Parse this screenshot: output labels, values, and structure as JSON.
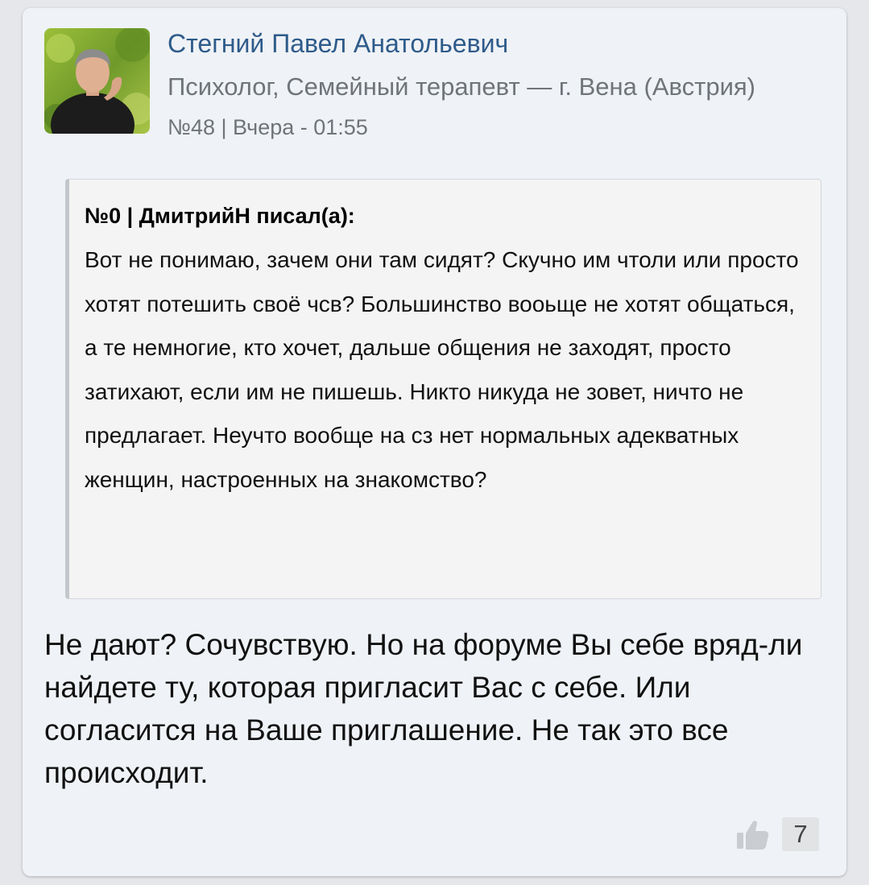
{
  "post": {
    "author": {
      "name": "Стегний Павел Анатольевич",
      "role": "Психолог, Семейный терапевт — г. Вена (Австрия)"
    },
    "meta": "№48 | Вчера - 01:55",
    "quote": {
      "header": "№0 | ДмитрийН писал(а):",
      "text": "Вот не понимаю, зачем они там сидят? Скучно им чтоли или просто хотят потешить своё чсв? Большинство вооьще не хотят общаться, а те немногие, кто хочет, дальше общения не заходят, просто затихают, если им не пишешь. Никто никуда не зовет, ничто не предлагает. Неучто вообще на сз нет нормальных адекватных женщин, настроенных на знакомство?"
    },
    "body": "Не дают? Сочувствую. Но на форуме Вы себе вряд-ли найдете ту, которая пригласит Вас с себе. Или согласится на Ваше приглашение. Не так это все происходит.",
    "likes": {
      "icon": "thumbs-up-icon",
      "count": "7"
    }
  },
  "colors": {
    "page_background": "#e6e7eb",
    "card_background": "#eff2f6",
    "author_name": "#2e5b8a",
    "secondary_text": "#6f7479",
    "quote_background": "#f4f4f4"
  }
}
